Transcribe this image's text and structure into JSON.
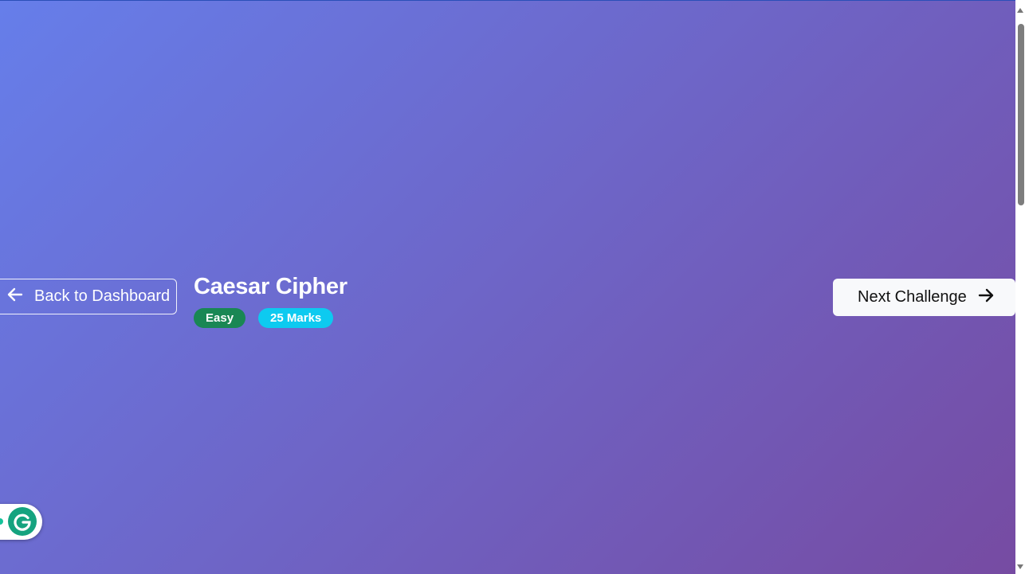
{
  "theme": {
    "gradient_start": "#667eea",
    "gradient_end": "#764ba2",
    "easy_color": "#198754",
    "marks_color": "#0dcaf0"
  },
  "nav": {
    "back_label": "Back to Dashboard",
    "next_label": "Next Challenge"
  },
  "challenge": {
    "title": "Caesar Cipher",
    "difficulty": "Easy",
    "marks": "25 Marks"
  },
  "icons": {
    "back": "arrow-left-icon",
    "next": "arrow-right-icon",
    "grammarly": "grammarly-icon"
  }
}
